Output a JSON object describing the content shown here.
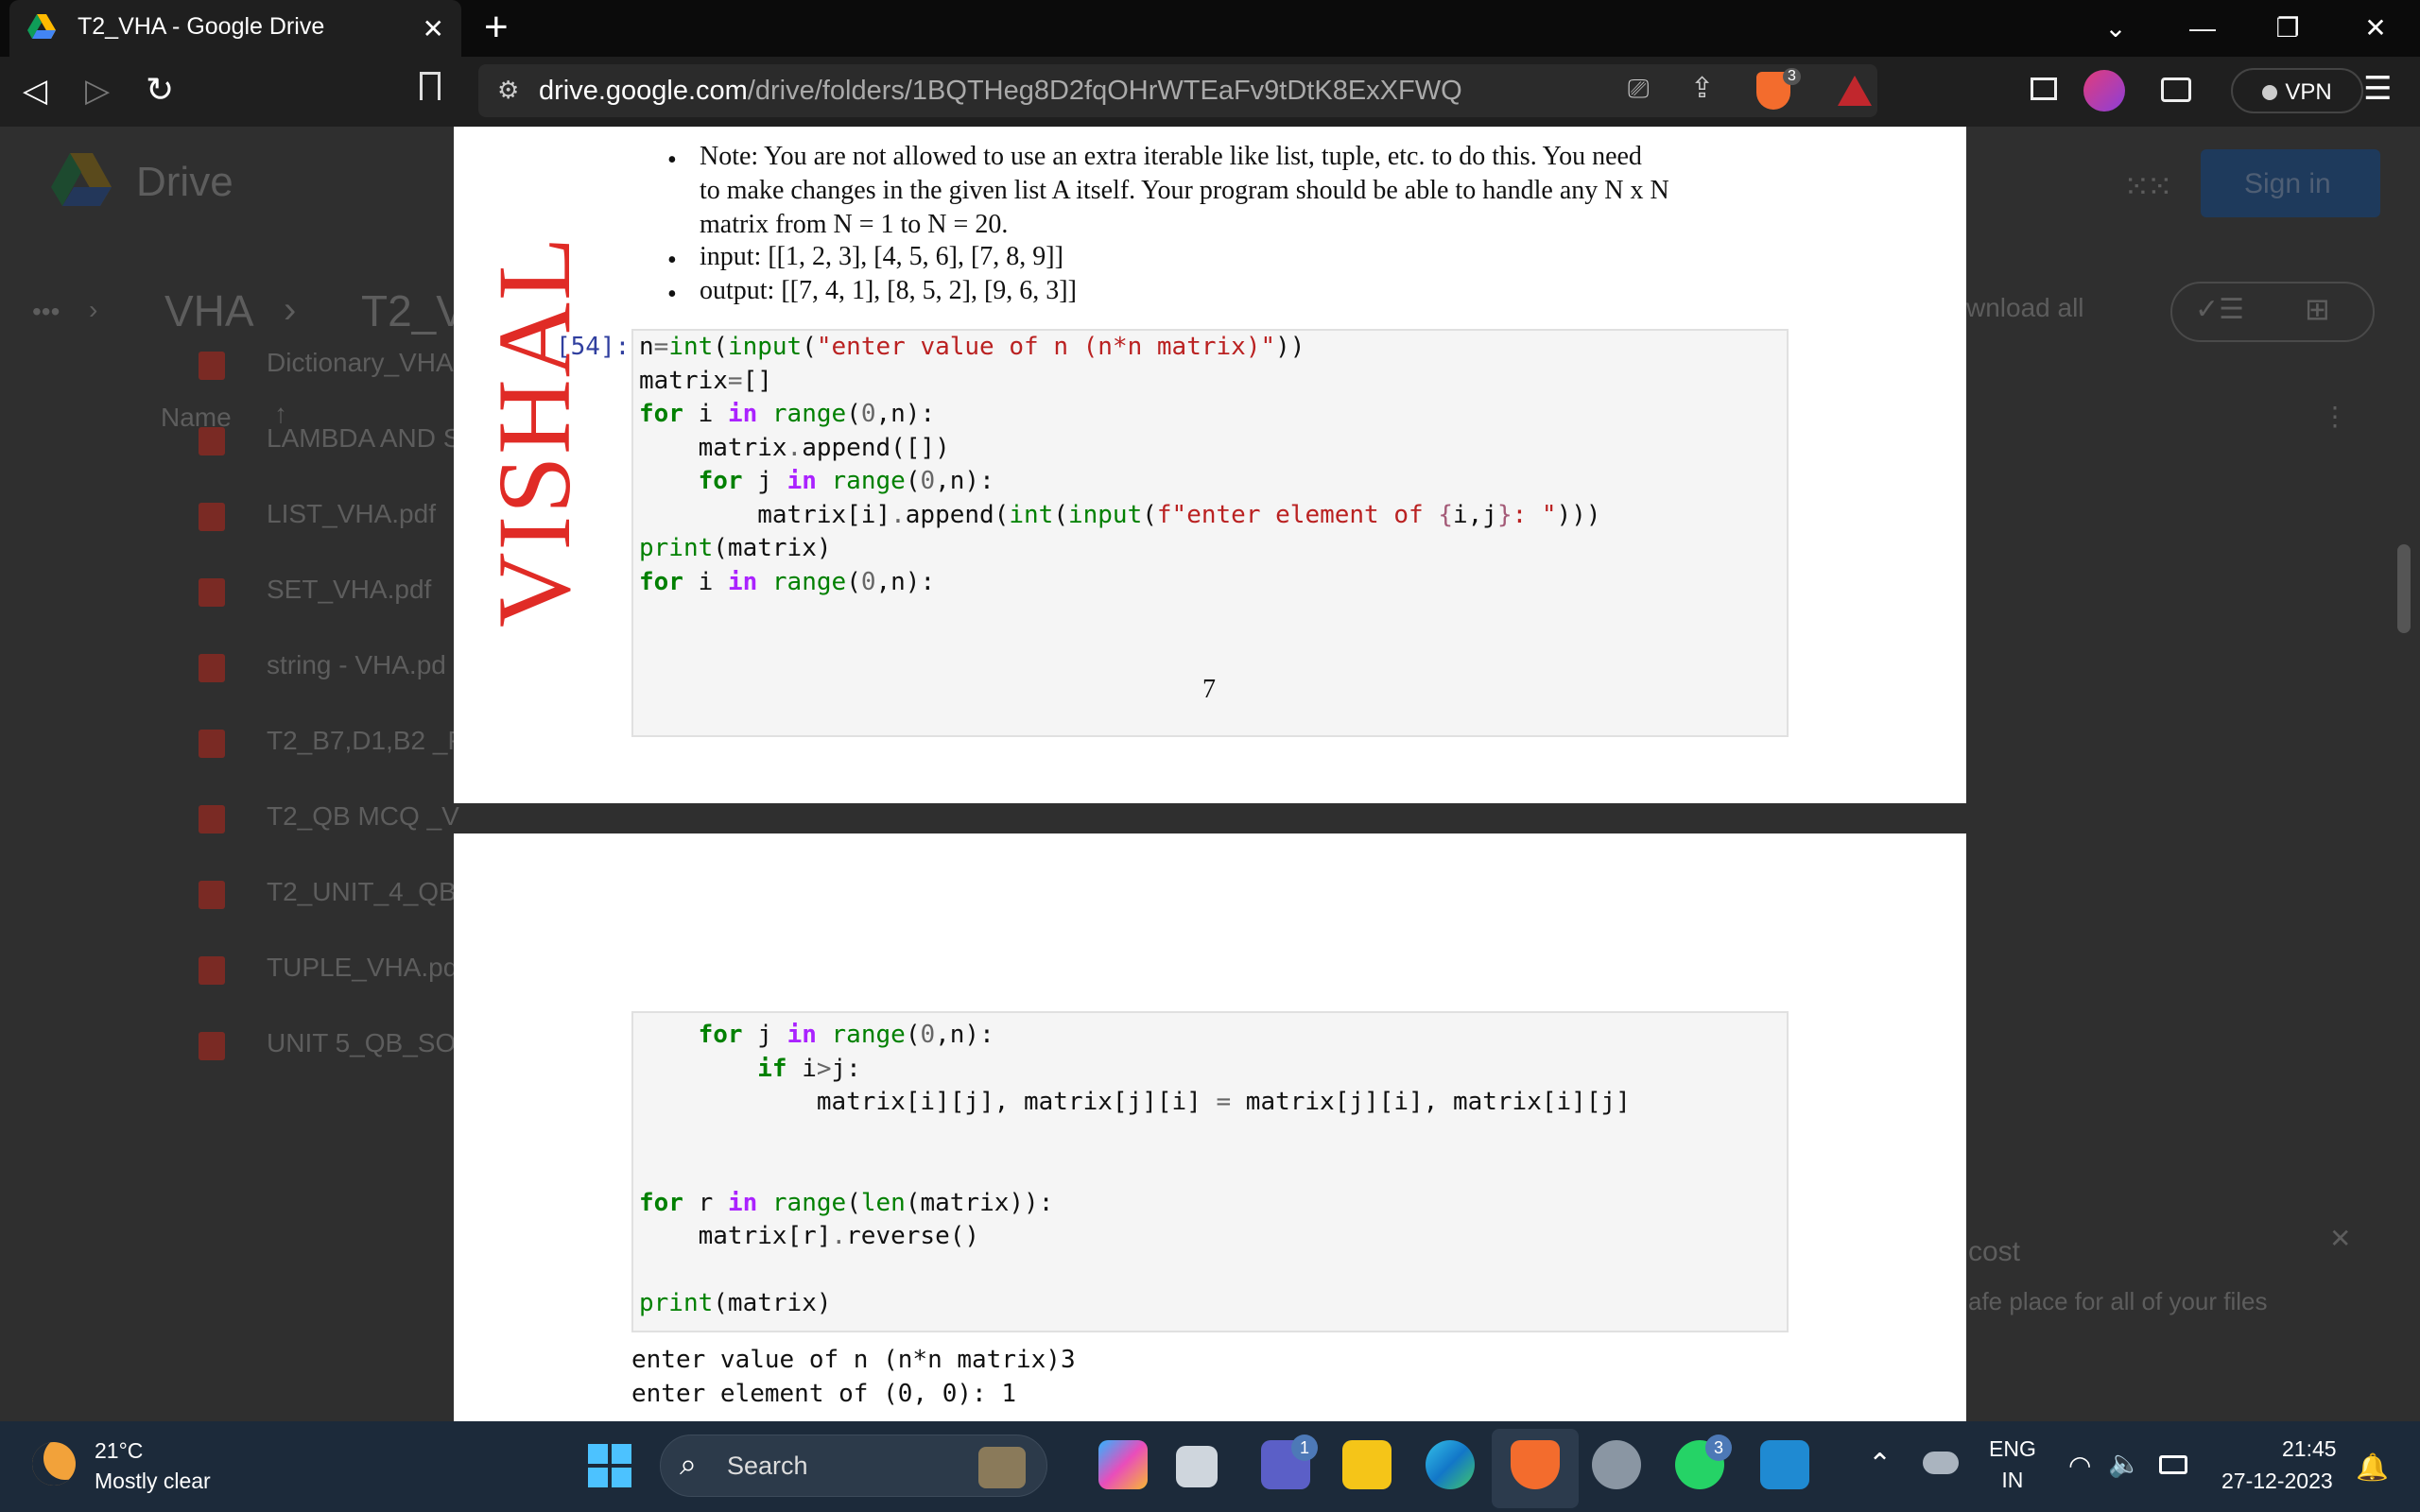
{
  "browser": {
    "tab_title": "T2_VHA - Google Drive",
    "tab_close": "✕",
    "new_tab": "+",
    "url_host": "drive.google.com",
    "url_path": "/drive/folders/1BQTHeg8D2fqOHrWTEaFv9tDtK8ExXFWQ",
    "shield_count": "3",
    "vpn_label": "VPN"
  },
  "drive": {
    "logo_text": "Drive",
    "sign_in": "Sign in",
    "breadcrumb": [
      "VHA",
      "T2_V"
    ],
    "breadcrumb_more": "•••",
    "download_all": "wnload all",
    "name_header": "Name",
    "files": [
      "Dictionary_VHA",
      "LAMBDA AND S",
      "LIST_VHA.pdf",
      "SET_VHA.pdf",
      "string - VHA.pd",
      "T2_B7,D1,B2 _P",
      "T2_QB MCQ _V",
      "T2_UNIT_4_QB_",
      "TUPLE_VHA.pd",
      "UNIT 5_QB_SO"
    ],
    "promo_title": "cost",
    "promo_text": "afe place for all of your files"
  },
  "document": {
    "watermark": "VISHAL",
    "bullets": [
      "Note: You are not allowed to use an extra iterable like list, tuple, etc. to do this. You need",
      "to make changes in the given list A itself. Your program should be able to handle any N x N",
      "matrix from N = 1 to N = 20."
    ],
    "input_line": "input: [[1, 2, 3], [4, 5, 6], [7, 8, 9]]",
    "output_line": "output: [[7, 4, 1], [8, 5, 2], [9, 6, 3]]",
    "cell_prompt": "[54]:",
    "page_number": "7",
    "output_text": [
      "enter value of n (n*n matrix)3",
      "enter element of (0, 0): 1"
    ]
  },
  "taskbar": {
    "temperature": "21°C",
    "weather": "Mostly clear",
    "search_placeholder": "Search",
    "teams_badge": "1",
    "whatsapp_badge": "3",
    "lang_line1": "ENG",
    "lang_line2": "IN",
    "time": "21:45",
    "date": "27-12-2023"
  }
}
